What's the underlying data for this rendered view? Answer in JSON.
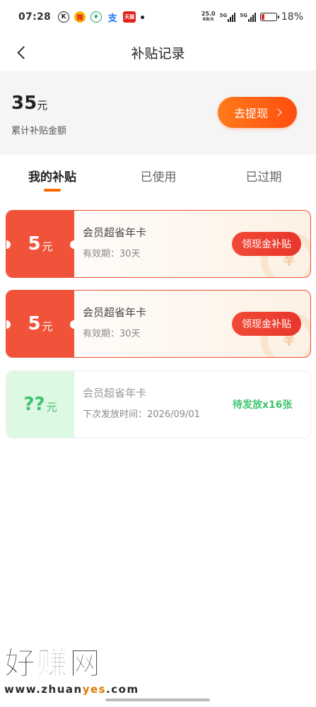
{
  "status_bar": {
    "time": "07:28",
    "app_icons": [
      "k-icon",
      "weibo-icon",
      "leaf-icon",
      "zhi-icon",
      "tmall-icon",
      "dot-icon"
    ],
    "icon_glyphs": {
      "k": "K",
      "weibo": "微",
      "leaf": "❦",
      "zhi": "支",
      "tmall": "天猫"
    },
    "net_speed_value": "25.0",
    "net_speed_unit": "KB/S",
    "sig1_label": "5G",
    "sig2_label": "5G",
    "battery_percent": 18,
    "battery_text": "18%"
  },
  "nav": {
    "title": "补贴记录"
  },
  "summary": {
    "amount": "35",
    "unit": "元",
    "label": "累计补贴金额",
    "withdraw_label": "去提现"
  },
  "tabs": [
    {
      "label": "我的补贴",
      "active": true
    },
    {
      "label": "已使用",
      "active": false
    },
    {
      "label": "已过期",
      "active": false
    }
  ],
  "cards": [
    {
      "amount": "5",
      "unit": "元",
      "title": "会员超省年卡",
      "subtitle": "有效期：30天",
      "action": "领现金补贴",
      "coin_glyph": "¥"
    },
    {
      "amount": "5",
      "unit": "元",
      "title": "会员超省年卡",
      "subtitle": "有效期：30天",
      "action": "领现金补贴",
      "coin_glyph": "¥"
    },
    {
      "amount": "??",
      "unit": "元",
      "title": "会员超省年卡",
      "subtitle": "下次发放时间：2026/09/01",
      "status": "待发放x16张"
    }
  ],
  "watermark": {
    "title": "好赚网",
    "url_pre": "www.zhuan",
    "url_highlight": "yes",
    "url_post": ".com"
  },
  "colors": {
    "accent_orange": "#ff6a00",
    "card_red": "#f0523a",
    "pending_green": "#3ec46d"
  }
}
